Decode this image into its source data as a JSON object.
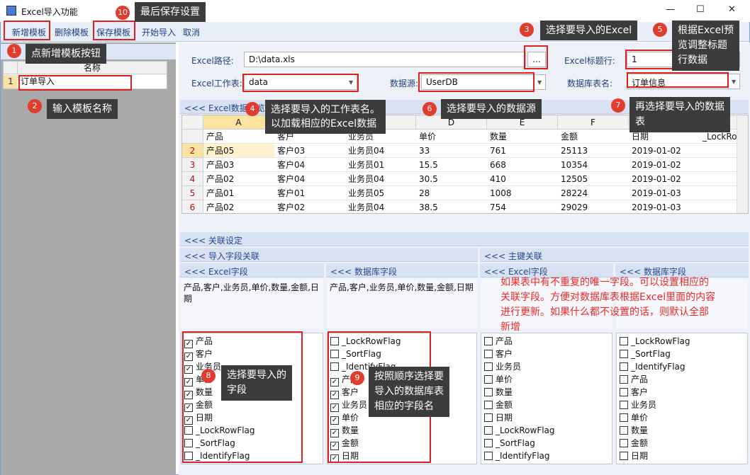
{
  "window": {
    "title": "Excel导入功能",
    "minimize": "—",
    "maximize": "☐",
    "close": "✕"
  },
  "toolbar": {
    "new": "新增模板",
    "delete": "删除模板",
    "save": "保存模板",
    "start": "开始导入",
    "cancel": "取消"
  },
  "left": {
    "col_header": "名称",
    "row_num": "1",
    "row_value": "订单导入"
  },
  "form": {
    "path_label": "Excel路径:",
    "path_value": "D:\\data.xls",
    "browse": "...",
    "title_row_label": "Excel标题行:",
    "title_row_value": "1",
    "sheet_label": "Excel工作表:",
    "sheet_value": "data",
    "source_label": "数据源:",
    "source_value": "UserDB",
    "table_label": "数据库表名:",
    "table_value": "订单信息"
  },
  "excel_section": "<<< Excel数据预览",
  "grid": {
    "col_letters": [
      "A",
      "B",
      "C",
      "D",
      "E",
      "F",
      "G",
      "H"
    ],
    "header_row": [
      "产品",
      "客户",
      "业务员",
      "单价",
      "数量",
      "金额",
      "日期",
      "_LockRo"
    ],
    "rows": [
      {
        "n": "2",
        "cells": [
          "产品05",
          "客户03",
          "业务员04",
          "33",
          "761",
          "25113",
          "2019-01-02",
          ""
        ]
      },
      {
        "n": "3",
        "cells": [
          "产品03",
          "客户04",
          "业务员01",
          "15.5",
          "668",
          "10354",
          "2019-01-02",
          ""
        ]
      },
      {
        "n": "4",
        "cells": [
          "产品02",
          "客户04",
          "业务员04",
          "30.5",
          "410",
          "12505",
          "2019-01-02",
          ""
        ]
      },
      {
        "n": "5",
        "cells": [
          "产品01",
          "客户01",
          "业务员05",
          "28",
          "1008",
          "28224",
          "2019-01-03",
          ""
        ]
      },
      {
        "n": "6",
        "cells": [
          "产品02",
          "客户02",
          "业务员04",
          "38.5",
          "754",
          "29029",
          "2019-01-03",
          ""
        ]
      }
    ]
  },
  "relation": {
    "title": "<<< 关联设定",
    "import_fields": "<<< 导入字段关联",
    "primary_key": "<<< 主键关联",
    "excel_fields": "<<< Excel字段",
    "db_fields": "<<< 数据库字段",
    "excel_field_list": "产品,客户,业务员,单价,数量,金额,日期",
    "db_field_list": "产品,客户,业务员,单价,数量,金额,日期"
  },
  "checklists": {
    "excel": [
      {
        "label": "产品",
        "checked": true
      },
      {
        "label": "客户",
        "checked": true
      },
      {
        "label": "业务员",
        "checked": true
      },
      {
        "label": "单价",
        "checked": true
      },
      {
        "label": "数量",
        "checked": true
      },
      {
        "label": "金额",
        "checked": true
      },
      {
        "label": "日期",
        "checked": true
      },
      {
        "label": "_LockRowFlag",
        "checked": false
      },
      {
        "label": "_SortFlag",
        "checked": false
      },
      {
        "label": "_IdentifyFlag",
        "checked": false
      }
    ],
    "db": [
      {
        "label": "_LockRowFlag",
        "checked": false
      },
      {
        "label": "_SortFlag",
        "checked": false
      },
      {
        "label": "_IdentifyFlag",
        "checked": false
      },
      {
        "label": "产品",
        "checked": true
      },
      {
        "label": "客户",
        "checked": true
      },
      {
        "label": "业务员",
        "checked": true
      },
      {
        "label": "单价",
        "checked": true
      },
      {
        "label": "数量",
        "checked": true
      },
      {
        "label": "金额",
        "checked": true
      },
      {
        "label": "日期",
        "checked": true
      }
    ],
    "pk_excel": [
      {
        "label": "产品",
        "checked": false
      },
      {
        "label": "客户",
        "checked": false
      },
      {
        "label": "业务员",
        "checked": false
      },
      {
        "label": "单价",
        "checked": false
      },
      {
        "label": "数量",
        "checked": false
      },
      {
        "label": "金额",
        "checked": false
      },
      {
        "label": "日期",
        "checked": false
      },
      {
        "label": "_LockRowFlag",
        "checked": false
      },
      {
        "label": "_SortFlag",
        "checked": false
      },
      {
        "label": "_IdentifyFlag",
        "checked": false
      }
    ],
    "pk_db": [
      {
        "label": "_LockRowFlag",
        "checked": false
      },
      {
        "label": "_SortFlag",
        "checked": false
      },
      {
        "label": "_IdentifyFlag",
        "checked": false
      },
      {
        "label": "产品",
        "checked": false
      },
      {
        "label": "客户",
        "checked": false
      },
      {
        "label": "业务员",
        "checked": false
      },
      {
        "label": "单价",
        "checked": false
      },
      {
        "label": "数量",
        "checked": false
      },
      {
        "label": "金额",
        "checked": false
      },
      {
        "label": "日期",
        "checked": false
      }
    ]
  },
  "tips": {
    "t1": "点新增模板按钮",
    "t2": "输入模板名称",
    "t3": "选择要导入的Excel",
    "t4a": "选择要导入的工作表名。",
    "t4b": "以加载相应的Excel数据",
    "t5a": "根据Excel预",
    "t5b": "览调整标题",
    "t5c": "行数据",
    "t6": "选择要导入的数据源",
    "t7a": "再选择要导入的数据",
    "t7b": "表",
    "t8a": "选择要导入的",
    "t8b": "字段",
    "t9a": "按照顺序选择要",
    "t9b": "导入的数据库表",
    "t9c": "相应的字段名",
    "t10": "最后保存设置"
  },
  "badges": [
    "1",
    "2",
    "3",
    "4",
    "5",
    "6",
    "7",
    "8",
    "9",
    "10"
  ],
  "note": {
    "l1": "如果表中有不重复的唯一字段。可以设置相应的",
    "l2": "关联字段。方便对数据库表根据Excel里面的内容",
    "l3": "进行更新。如果什么都不设置的话，则默认全部",
    "l4": "新增"
  },
  "colors": {
    "accent": "#1d3f84",
    "badge": "#e23c2e",
    "note": "#ec2828"
  }
}
